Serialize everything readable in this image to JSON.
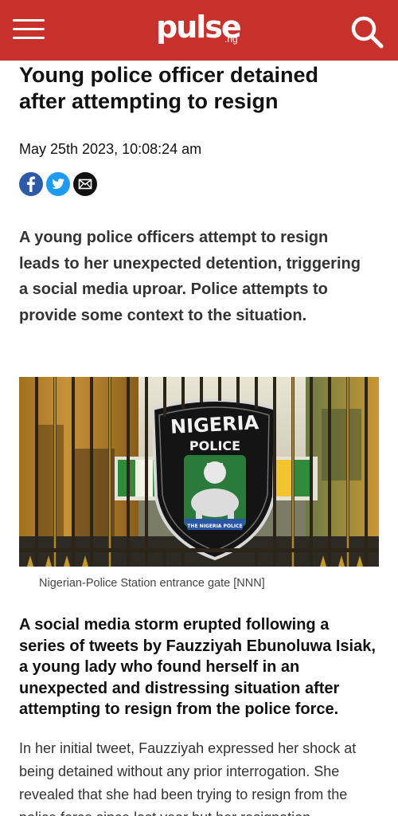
{
  "header": {
    "logo_word": "pulse",
    "logo_tld": ".ng",
    "menu_icon": "hamburger-menu-icon",
    "search_icon": "search-icon",
    "brand_color": "#c8302c"
  },
  "article": {
    "headline": "Young police officer detained after attempting to resign",
    "date": "May 25th 2023, 10:08:24 am",
    "share_icons": [
      "facebook-icon",
      "twitter-icon",
      "email-icon"
    ],
    "lede": "A young police officers attempt to resign leads to her unexpected detention, triggering a social media uproar. Police attempts to provide some context to the situation.",
    "image": {
      "sign_line1": "NIGERIA",
      "sign_line2": "POLICE",
      "sign_badge": "THE NIGERIA POLICE",
      "caption": "Nigerian-Police Station entrance gate [NNN]"
    },
    "subhead": "A social media storm erupted following a series of tweets by Fauzziyah Ebunoluwa Isiak, a young lady who found herself in an unexpected and distressing situation after attempting to resign from the police force.",
    "body": "In her initial tweet, Fauzziyah expressed her shock at being detained without any prior interrogation. She revealed that she had been trying to resign from the police force since last year but her resignation"
  }
}
